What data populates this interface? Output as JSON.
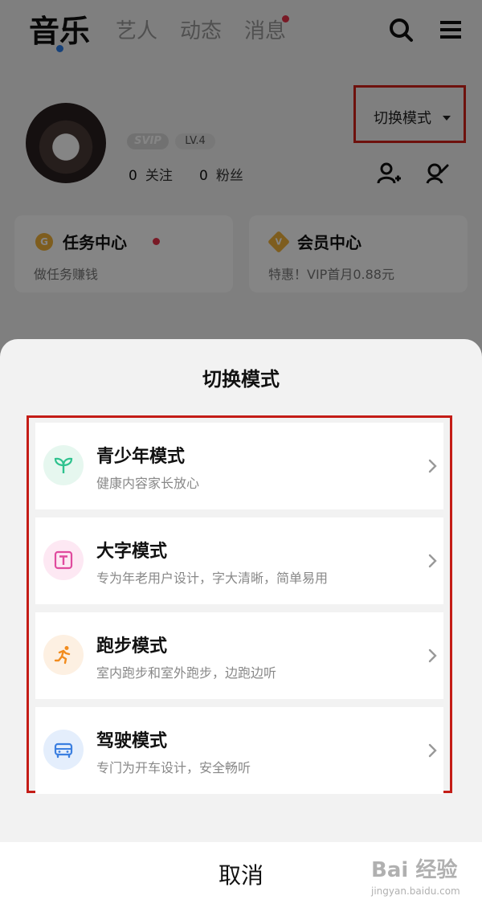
{
  "topnav": {
    "tabs": [
      {
        "label": "音乐"
      },
      {
        "label": "艺人"
      },
      {
        "label": "动态"
      },
      {
        "label": "消息"
      }
    ]
  },
  "profile": {
    "svip": "SVIP",
    "level": "LV.4",
    "following_count": "0",
    "following_label": "关注",
    "fans_count": "0",
    "fans_label": "粉丝",
    "switch_mode_label": "切换模式"
  },
  "cards": [
    {
      "icon_text": "G",
      "title": "任务中心",
      "subtitle": "做任务赚钱"
    },
    {
      "icon_text": "V",
      "title": "会员中心",
      "subtitle": "特惠！VIP首月0.88元"
    }
  ],
  "sheet": {
    "title": "切换模式",
    "items": [
      {
        "name": "青少年模式",
        "desc": "健康内容家长放心",
        "icon": "sprout-icon",
        "color": "#2ec28e"
      },
      {
        "name": "大字模式",
        "desc": "专为年老用户设计，字大清晰，简单易用",
        "icon": "text-t-icon",
        "color": "#e04a9e"
      },
      {
        "name": "跑步模式",
        "desc": "室内跑步和室外跑步，边跑边听",
        "icon": "runner-icon",
        "color": "#f28c1e"
      },
      {
        "name": "驾驶模式",
        "desc": "专门为开车设计，安全畅听",
        "icon": "car-icon",
        "color": "#3b7fe0"
      }
    ],
    "cancel_label": "取消"
  },
  "watermark": {
    "main": "Bai 经验",
    "sub": "jingyan.baidu.com"
  }
}
